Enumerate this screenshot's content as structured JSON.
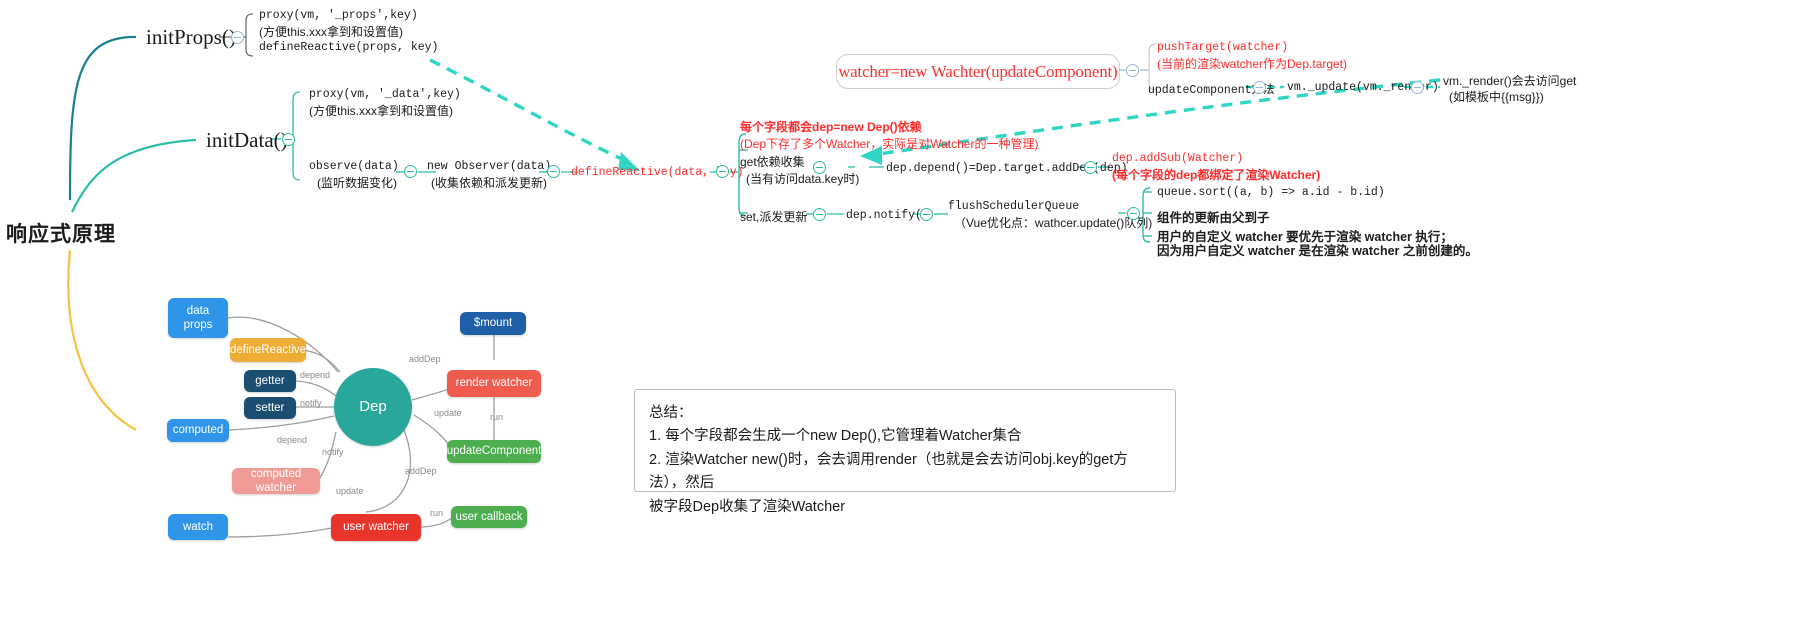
{
  "root": {
    "title": "响应式原理"
  },
  "branches": {
    "init_props": {
      "label": "initProps()",
      "children": [
        {
          "line1": "proxy(vm, '_props',key)",
          "line2": "(方便this.xxx拿到和设置值)"
        },
        {
          "line1": "defineReactive(props, key)"
        }
      ]
    },
    "init_data": {
      "label": "initData()",
      "children": [
        {
          "line1": "proxy(vm, '_data',key)",
          "line2": "(方便this.xxx拿到和设置值)"
        },
        {
          "line1": "observe(data)",
          "line2": "(监听数据变化)"
        }
      ]
    },
    "new_observer": {
      "line1": "new Observer(data)",
      "line2": "(收集依赖和派发更新)"
    },
    "define_reactive": {
      "label": "defineReactive(data, key)"
    },
    "dep_note": {
      "line1": "每个字段都会dep=new Dep()依赖",
      "line2": "(Dep下存了多个Watcher，实际是对Watcher的一种管理)"
    },
    "getter": {
      "line1": "get依赖收集",
      "line2": "(当有访问data.key时)"
    },
    "setter": {
      "label": "set,派发更新"
    },
    "dep_depend": {
      "label": "dep.depend()=Dep.target.addDep(dep)"
    },
    "dep_addsub": {
      "line1": "dep.addSub(Watcher)",
      "line2": "(每个字段的dep都绑定了渲染Watcher)"
    },
    "dep_notify": {
      "label": "dep.notify()"
    },
    "flush": {
      "line1": "flushSchedulerQueue",
      "line2": "（Vue优化点：wathcer.update()队列)"
    },
    "queue_notes": [
      "queue.sort((a, b) => a.id - b.id)",
      "组件的更新由父到子",
      "用户的自定义 watcher 要优先于渲染 watcher 执行；",
      "因为用户自定义 watcher 是在渲染 watcher 之前创建的。"
    ]
  },
  "watcher_flow": {
    "box_label": "watcher=new Wachter(updateComponent)",
    "push_target": {
      "line1": "pushTarget(watcher)",
      "line2": "(当前的渲染watcher作为Dep.target)"
    },
    "update_component": {
      "label": "updateComponent方法"
    },
    "vm_update": {
      "label": "vm._update(vm._render)"
    },
    "vm_render": {
      "line1": "vm._render()会去访问get",
      "line2": "(如模板中{{msg}})"
    }
  },
  "summary": {
    "title": "总结：",
    "line1": "1. 每个字段都会生成一个new Dep(),它管理着Watcher集合",
    "line2": "2. 渲染Watcher new()时，会去调用render（也就是会去访问obj.key的get方法），然后",
    "line3": "被字段Dep收集了渲染Watcher"
  },
  "mindmap": {
    "nodes": [
      {
        "id": "data-props",
        "label": "data\nprops",
        "color": "#2f95e8"
      },
      {
        "id": "define-reactive",
        "label": "defineReactive",
        "color": "#f0ad36"
      },
      {
        "id": "getter",
        "label": "getter",
        "color": "#1b4f72"
      },
      {
        "id": "setter",
        "label": "setter",
        "color": "#1b4f72"
      },
      {
        "id": "computed",
        "label": "computed",
        "color": "#2f95e8"
      },
      {
        "id": "computed-watcher",
        "label": "computed watcher",
        "color": "#ef9a95"
      },
      {
        "id": "watch",
        "label": "watch",
        "color": "#2f95e8"
      },
      {
        "id": "dep",
        "label": "Dep",
        "color": "#2aa79b"
      },
      {
        "id": "mount",
        "label": "$mount",
        "color": "#1f5fa8"
      },
      {
        "id": "render-watcher",
        "label": "render watcher",
        "color": "#ef5b4c"
      },
      {
        "id": "update-component",
        "label": "updateComponent",
        "color": "#4cae4f"
      },
      {
        "id": "user-watcher",
        "label": "user watcher",
        "color": "#e8342a"
      },
      {
        "id": "user-callback",
        "label": "user callback",
        "color": "#4cae4f"
      }
    ],
    "edges": [
      {
        "label": "addDep"
      },
      {
        "label": "depend"
      },
      {
        "label": "notify"
      },
      {
        "label": "update"
      },
      {
        "label": "run"
      },
      {
        "label": "depend"
      },
      {
        "label": "notify"
      },
      {
        "label": "addDep"
      },
      {
        "label": "update"
      },
      {
        "label": "run"
      }
    ]
  },
  "colors": {
    "teal": "#2bbda6",
    "dark_teal": "#1b7f8e",
    "yellow": "#f5c242",
    "red": "#ff2d2d",
    "dash": "#2fd6c3"
  }
}
